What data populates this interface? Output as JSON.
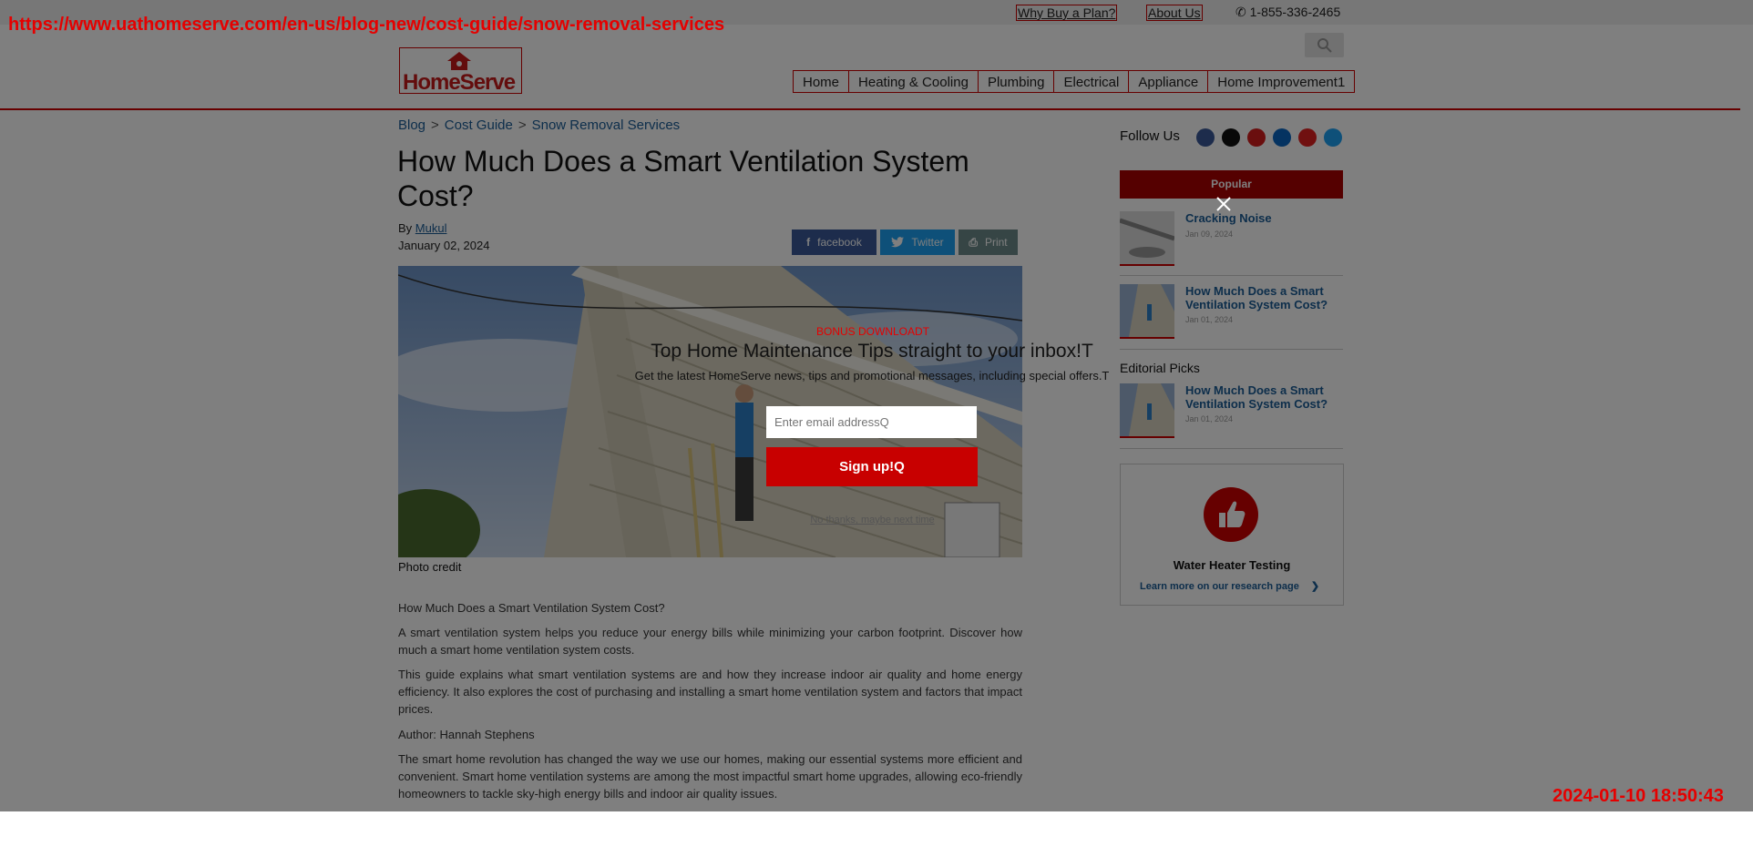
{
  "stamps": {
    "url": "https://www.uathomeserve.com/en-us/blog-new/cost-guide/snow-removal-services",
    "timestamp": "2024-01-10 18:50:43"
  },
  "topbar": {
    "why_buy": "Why Buy a Plan?",
    "about": "About Us",
    "phone": "1-855-336-2465"
  },
  "logo": {
    "text": "HomeServe"
  },
  "nav": [
    "Home",
    "Heating & Cooling",
    "Plumbing",
    "Electrical",
    "Appliance",
    "Home Improvement1"
  ],
  "breadcrumb": [
    "Blog",
    "Cost Guide",
    "Snow Removal Services"
  ],
  "breadcrumb_sep": ">",
  "article": {
    "title": "How Much Does a Smart Ventilation System Cost?",
    "by_label": "By",
    "author": "Mukul",
    "date": "January 02, 2024",
    "photo_credit": "Photo credit",
    "paragraphs": [
      "How Much Does a Smart Ventilation System Cost?",
      "A smart ventilation system helps you reduce your energy bills while minimizing your carbon footprint. Discover how much a smart home ventilation system costs.",
      "This guide explains what smart ventilation systems are and how they increase indoor air quality and home energy efficiency. It also explores the cost of purchasing and installing a smart home ventilation system and factors that impact prices.",
      "Author: Hannah Stephens",
      "The smart home revolution has changed the way we use our homes, making our essential systems more efficient and convenient. Smart home ventilation systems are among the most impactful smart home upgrades, allowing eco-friendly homeowners to tackle sky-high energy bills and indoor air quality issues."
    ]
  },
  "share": {
    "facebook": "facebook",
    "twitter": "Twitter",
    "print": "Print"
  },
  "sidebar": {
    "follow_us": "Follow Us",
    "popular": "Popular",
    "popular_items": [
      {
        "title": "Cracking Noise",
        "date": "Jan 09, 2024"
      },
      {
        "title": "How Much Does a Smart Ventilation System Cost?",
        "date": "Jan 01, 2024"
      }
    ],
    "editorial_picks": "Editorial Picks",
    "editorial_items": [
      {
        "title": "How Much Does a Smart Ventilation System Cost?",
        "date": "Jan 01, 2024"
      }
    ],
    "card": {
      "title": "Water Heater Testing",
      "link": "Learn more on our research page"
    }
  },
  "modal": {
    "tag": "BONUS DOWNLOADT",
    "heading": "Top Home Maintenance Tips straight to your inbox!T",
    "subtext": "Get the latest HomeServe news, tips and promotional messages, including special offers.T",
    "email_placeholder": "Enter email addressQ",
    "signup": "Sign up!Q",
    "dismiss": "No thanks, maybe next time"
  },
  "colors": {
    "brand_red": "#c00000",
    "link_blue": "#1a5c97",
    "facebook": "#3b5998",
    "twitter": "#1da1f2",
    "print": "#6d8a8a",
    "overlay": "rgba(0,0,0,0.5)"
  }
}
